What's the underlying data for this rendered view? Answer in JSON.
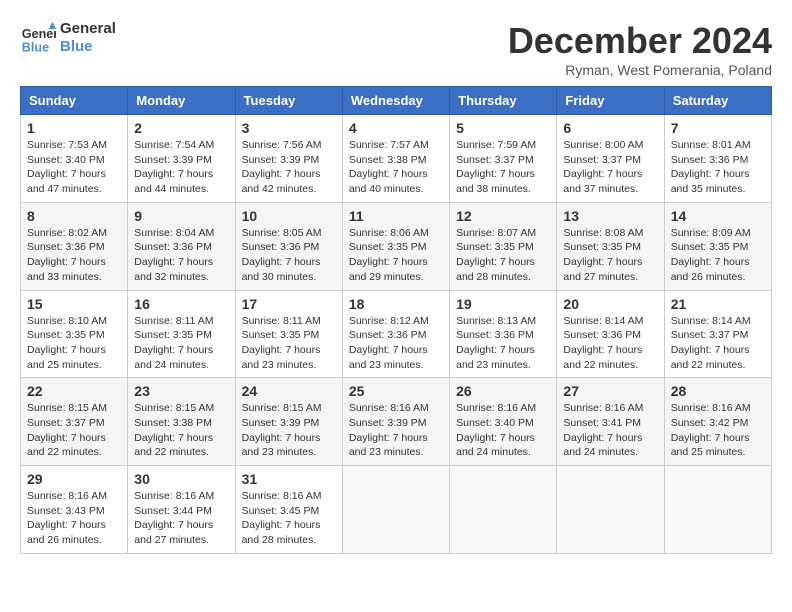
{
  "header": {
    "logo_line1": "General",
    "logo_line2": "Blue",
    "title": "December 2024",
    "subtitle": "Ryman, West Pomerania, Poland"
  },
  "days_of_week": [
    "Sunday",
    "Monday",
    "Tuesday",
    "Wednesday",
    "Thursday",
    "Friday",
    "Saturday"
  ],
  "weeks": [
    [
      {
        "day": "1",
        "content": "Sunrise: 7:53 AM\nSunset: 3:40 PM\nDaylight: 7 hours\nand 47 minutes."
      },
      {
        "day": "2",
        "content": "Sunrise: 7:54 AM\nSunset: 3:39 PM\nDaylight: 7 hours\nand 44 minutes."
      },
      {
        "day": "3",
        "content": "Sunrise: 7:56 AM\nSunset: 3:39 PM\nDaylight: 7 hours\nand 42 minutes."
      },
      {
        "day": "4",
        "content": "Sunrise: 7:57 AM\nSunset: 3:38 PM\nDaylight: 7 hours\nand 40 minutes."
      },
      {
        "day": "5",
        "content": "Sunrise: 7:59 AM\nSunset: 3:37 PM\nDaylight: 7 hours\nand 38 minutes."
      },
      {
        "day": "6",
        "content": "Sunrise: 8:00 AM\nSunset: 3:37 PM\nDaylight: 7 hours\nand 37 minutes."
      },
      {
        "day": "7",
        "content": "Sunrise: 8:01 AM\nSunset: 3:36 PM\nDaylight: 7 hours\nand 35 minutes."
      }
    ],
    [
      {
        "day": "8",
        "content": "Sunrise: 8:02 AM\nSunset: 3:36 PM\nDaylight: 7 hours\nand 33 minutes."
      },
      {
        "day": "9",
        "content": "Sunrise: 8:04 AM\nSunset: 3:36 PM\nDaylight: 7 hours\nand 32 minutes."
      },
      {
        "day": "10",
        "content": "Sunrise: 8:05 AM\nSunset: 3:36 PM\nDaylight: 7 hours\nand 30 minutes."
      },
      {
        "day": "11",
        "content": "Sunrise: 8:06 AM\nSunset: 3:35 PM\nDaylight: 7 hours\nand 29 minutes."
      },
      {
        "day": "12",
        "content": "Sunrise: 8:07 AM\nSunset: 3:35 PM\nDaylight: 7 hours\nand 28 minutes."
      },
      {
        "day": "13",
        "content": "Sunrise: 8:08 AM\nSunset: 3:35 PM\nDaylight: 7 hours\nand 27 minutes."
      },
      {
        "day": "14",
        "content": "Sunrise: 8:09 AM\nSunset: 3:35 PM\nDaylight: 7 hours\nand 26 minutes."
      }
    ],
    [
      {
        "day": "15",
        "content": "Sunrise: 8:10 AM\nSunset: 3:35 PM\nDaylight: 7 hours\nand 25 minutes."
      },
      {
        "day": "16",
        "content": "Sunrise: 8:11 AM\nSunset: 3:35 PM\nDaylight: 7 hours\nand 24 minutes."
      },
      {
        "day": "17",
        "content": "Sunrise: 8:11 AM\nSunset: 3:35 PM\nDaylight: 7 hours\nand 23 minutes."
      },
      {
        "day": "18",
        "content": "Sunrise: 8:12 AM\nSunset: 3:36 PM\nDaylight: 7 hours\nand 23 minutes."
      },
      {
        "day": "19",
        "content": "Sunrise: 8:13 AM\nSunset: 3:36 PM\nDaylight: 7 hours\nand 23 minutes."
      },
      {
        "day": "20",
        "content": "Sunrise: 8:14 AM\nSunset: 3:36 PM\nDaylight: 7 hours\nand 22 minutes."
      },
      {
        "day": "21",
        "content": "Sunrise: 8:14 AM\nSunset: 3:37 PM\nDaylight: 7 hours\nand 22 minutes."
      }
    ],
    [
      {
        "day": "22",
        "content": "Sunrise: 8:15 AM\nSunset: 3:37 PM\nDaylight: 7 hours\nand 22 minutes."
      },
      {
        "day": "23",
        "content": "Sunrise: 8:15 AM\nSunset: 3:38 PM\nDaylight: 7 hours\nand 22 minutes."
      },
      {
        "day": "24",
        "content": "Sunrise: 8:15 AM\nSunset: 3:39 PM\nDaylight: 7 hours\nand 23 minutes."
      },
      {
        "day": "25",
        "content": "Sunrise: 8:16 AM\nSunset: 3:39 PM\nDaylight: 7 hours\nand 23 minutes."
      },
      {
        "day": "26",
        "content": "Sunrise: 8:16 AM\nSunset: 3:40 PM\nDaylight: 7 hours\nand 24 minutes."
      },
      {
        "day": "27",
        "content": "Sunrise: 8:16 AM\nSunset: 3:41 PM\nDaylight: 7 hours\nand 24 minutes."
      },
      {
        "day": "28",
        "content": "Sunrise: 8:16 AM\nSunset: 3:42 PM\nDaylight: 7 hours\nand 25 minutes."
      }
    ],
    [
      {
        "day": "29",
        "content": "Sunrise: 8:16 AM\nSunset: 3:43 PM\nDaylight: 7 hours\nand 26 minutes."
      },
      {
        "day": "30",
        "content": "Sunrise: 8:16 AM\nSunset: 3:44 PM\nDaylight: 7 hours\nand 27 minutes."
      },
      {
        "day": "31",
        "content": "Sunrise: 8:16 AM\nSunset: 3:45 PM\nDaylight: 7 hours\nand 28 minutes."
      },
      {
        "day": "",
        "content": ""
      },
      {
        "day": "",
        "content": ""
      },
      {
        "day": "",
        "content": ""
      },
      {
        "day": "",
        "content": ""
      }
    ]
  ]
}
